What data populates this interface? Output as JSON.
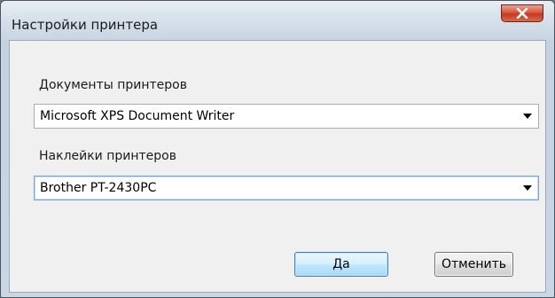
{
  "window": {
    "title": "Настройки принтера"
  },
  "document_printers": {
    "label": "Документы принтеров",
    "selected": "Microsoft XPS Document Writer"
  },
  "label_printers": {
    "label": "Наклейки принтеров",
    "selected": "Brother PT-2430PC"
  },
  "buttons": {
    "ok_label": "Да",
    "cancel_label": "Отменить"
  },
  "icons": {
    "close": "close-icon",
    "dropdown": "chevron-down-icon"
  },
  "colors": {
    "close_button": "#c9462b",
    "ok_border": "#3c7fb1",
    "client_background": "#f0f0f0"
  }
}
